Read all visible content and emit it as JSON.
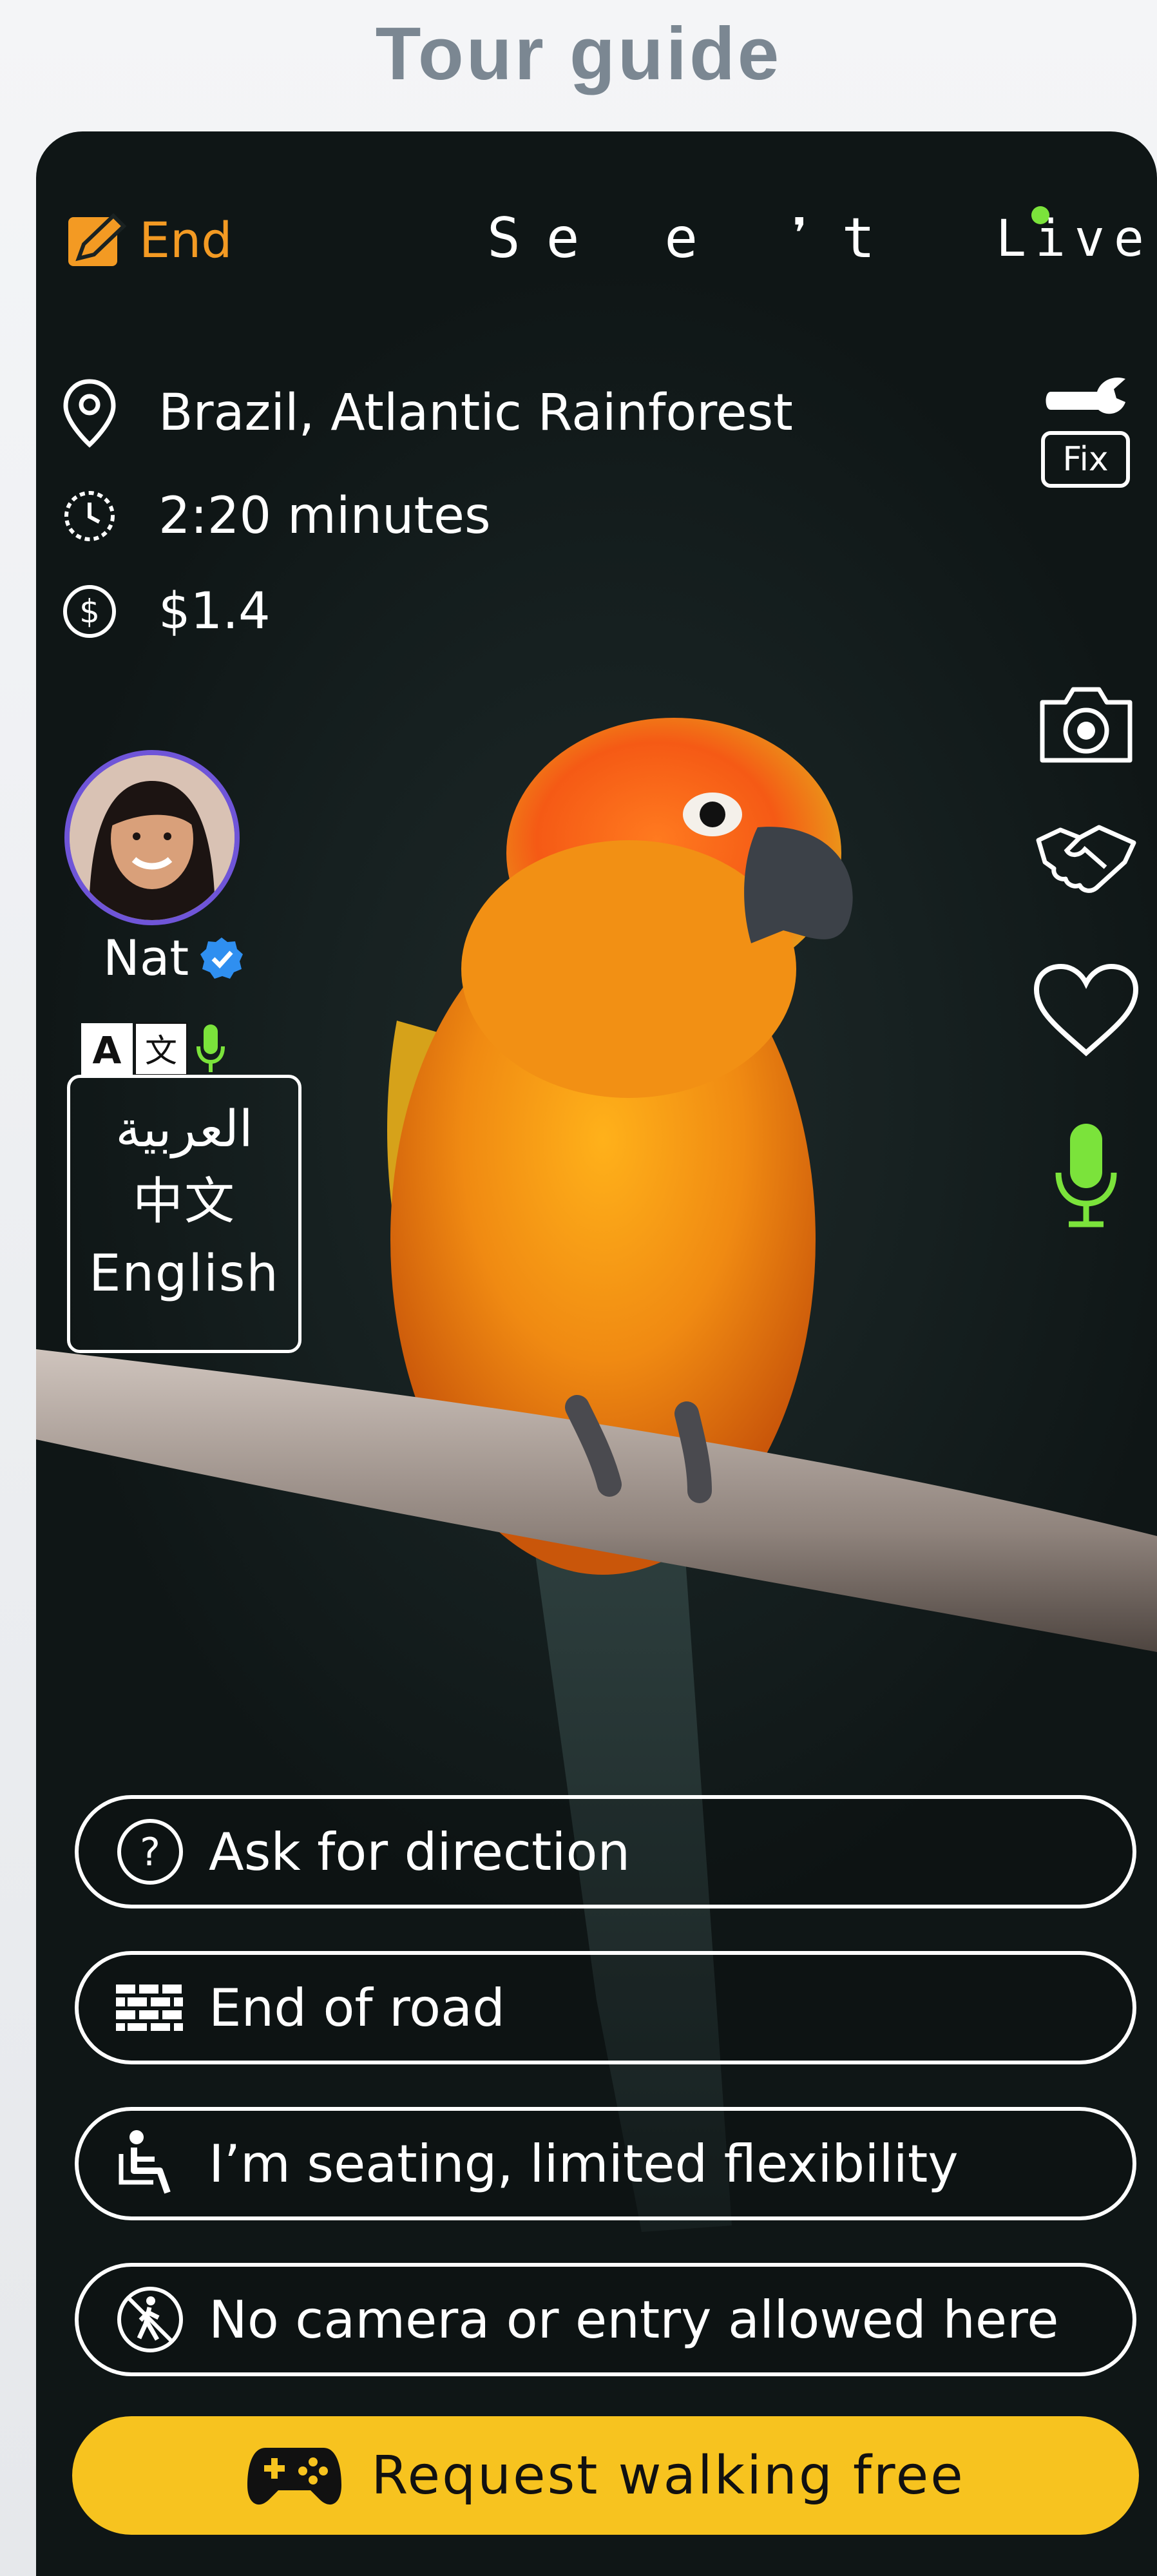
{
  "page": {
    "title": "Tour guide"
  },
  "top_bar": {
    "end_label": "End",
    "brand": "Se e ❜t",
    "live_label": "Live",
    "live_dot_color": "#7be33b",
    "end_color": "#f39a23"
  },
  "info": {
    "location": "Brazil, Atlantic Rainforest",
    "duration": "2:20 minutes",
    "price": "$1.4"
  },
  "tools": {
    "fix_label": "Fix"
  },
  "guide": {
    "name": "Nat",
    "languages": [
      "العربية",
      "中文",
      "English"
    ]
  },
  "actions": [
    {
      "label": "Ask for direction",
      "icon": "question-circle-icon"
    },
    {
      "label": "End of road",
      "icon": "brick-wall-icon"
    },
    {
      "label": "I’m seating, limited flexibility",
      "icon": "wheelchair-icon"
    },
    {
      "label": "No camera or entry allowed here",
      "icon": "no-entry-icon"
    }
  ],
  "cta": {
    "label": "Request walking free",
    "icon": "gamepad-icon",
    "color": "#f7c31f"
  }
}
